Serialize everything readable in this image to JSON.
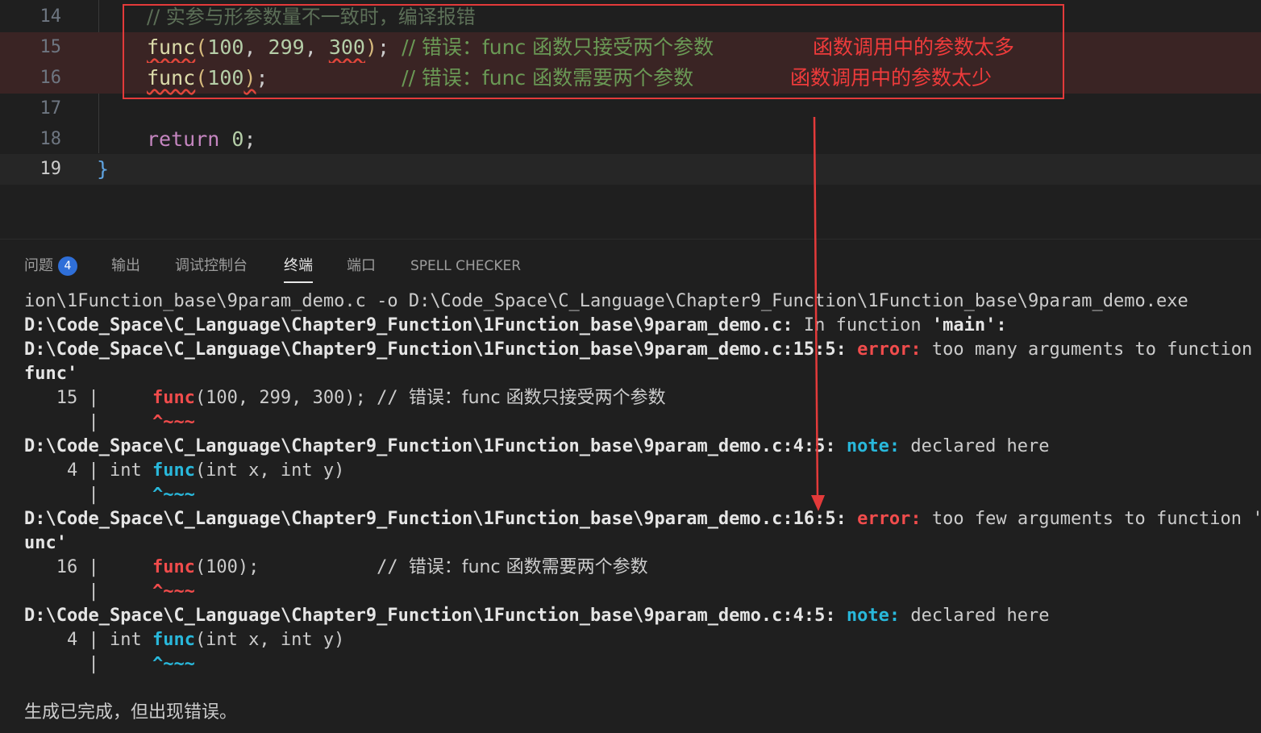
{
  "editor": {
    "lines": [
      {
        "num": "14",
        "comment": "// 实参与形参数量不一致时，编译报错"
      },
      {
        "num": "15",
        "fn": "func",
        "open": "(",
        "a1": "100",
        "sep1": ", ",
        "a2": "299",
        "sep2": ", ",
        "a3": "300",
        "close": ")",
        "semi": ";",
        "pad": " ",
        "comment": "// 错误：func 函数只接受两个参数"
      },
      {
        "num": "16",
        "fn": "func",
        "open": "(",
        "a1": "100",
        "close": ")",
        "semi": ";",
        "pad": "           ",
        "comment": "// 错误：func 函数需要两个参数"
      },
      {
        "num": "17"
      },
      {
        "num": "18",
        "kw": "return",
        "num_val": "0",
        "semi": ";"
      },
      {
        "num": "19",
        "brace": "}"
      }
    ],
    "annotations": {
      "too_many": "函数调用中的参数太多",
      "too_few": "函数调用中的参数太少"
    }
  },
  "panel": {
    "tabs": [
      {
        "label": "问题",
        "badge": "4"
      },
      {
        "label": "输出"
      },
      {
        "label": "调试控制台"
      },
      {
        "label": "终端"
      },
      {
        "label": "端口"
      },
      {
        "label": "SPELL CHECKER"
      }
    ],
    "active_tab": "终端"
  },
  "terminal": {
    "l1": "ion\\1Function_base\\9param_demo.c -o D:\\Code_Space\\C_Language\\Chapter9_Function\\1Function_base\\9param_demo.exe",
    "l2_path": "D:\\Code_Space\\C_Language\\Chapter9_Function\\1Function_base\\9param_demo.c:",
    "l2_rest": " In function ",
    "l2_main": "'main':",
    "l3_path": "D:\\Code_Space\\C_Language\\Chapter9_Function\\1Function_base\\9param_demo.c:15:5: ",
    "l3_err": "error:",
    "l3_msg": " too many arguments to function '",
    "l4": "func'",
    "l5_num": "   15 | ",
    "l5_fn": "    func",
    "l5_rest": "(100, 299, 300); // ",
    "l5_cn": "错误：func 函数只接受两个参数",
    "l6_bar": "      | ",
    "l6_caret": "    ^~~~",
    "l7_path": "D:\\Code_Space\\C_Language\\Chapter9_Function\\1Function_base\\9param_demo.c:4:5: ",
    "l7_note": "note:",
    "l7_msg": " declared here",
    "l8_num": "    4 | ",
    "l8_pre": "int ",
    "l8_fn": "func",
    "l8_rest": "(int x, int y)",
    "l9_bar": "      | ",
    "l9_caret": "    ^~~~",
    "l10_path": "D:\\Code_Space\\C_Language\\Chapter9_Function\\1Function_base\\9param_demo.c:16:5: ",
    "l10_err": "error:",
    "l10_msg": " too few arguments to function 'f",
    "l11": "unc'",
    "l12_num": "   16 | ",
    "l12_fn": "    func",
    "l12_rest": "(100);           // ",
    "l12_cn": "错误：func 函数需要两个参数",
    "l13_bar": "      | ",
    "l13_caret": "    ^~~~",
    "l14_path": "D:\\Code_Space\\C_Language\\Chapter9_Function\\1Function_base\\9param_demo.c:4:5: ",
    "l14_note": "note:",
    "l14_msg": " declared here",
    "l15_num": "    4 | ",
    "l15_pre": "int ",
    "l15_fn": "func",
    "l15_rest": "(int x, int y)",
    "l16_bar": "      | ",
    "l16_caret": "    ^~~~",
    "l17": "生成已完成，但出现错误。"
  },
  "colors": {
    "annotation": "#ef3b3b",
    "error": "#f14c4c",
    "note": "#29b8db",
    "badge": "#2f6fd8"
  }
}
